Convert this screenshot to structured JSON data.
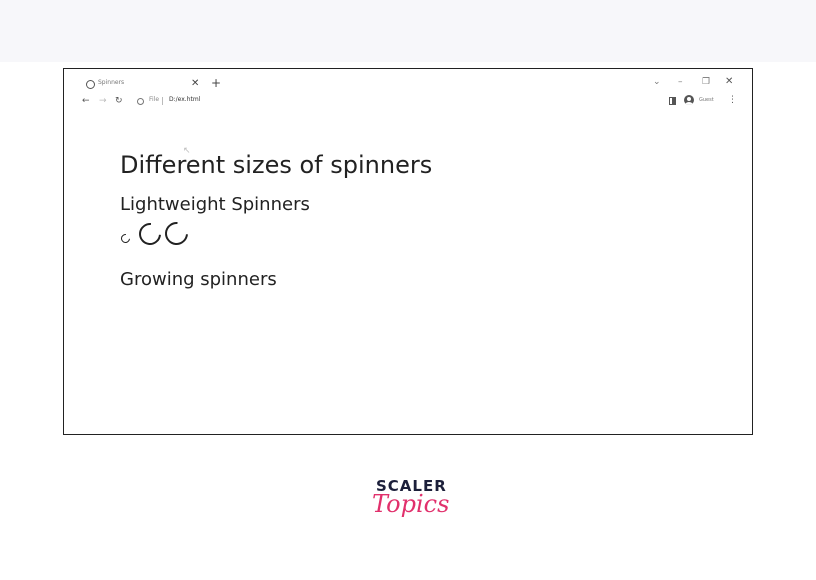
{
  "browser": {
    "tab": {
      "title": "Spinners",
      "close_glyph": "✕",
      "favicon": "globe-icon"
    },
    "new_tab_glyph": "+",
    "window_controls": {
      "tabs_menu": "⌄",
      "minimize": "–",
      "maximize": "❐",
      "close": "✕"
    },
    "toolbar": {
      "back": "←",
      "forward": "→",
      "reload": "↻",
      "scheme_label": "File",
      "url": "D:/ex.html",
      "profile_label": "Guest",
      "menu_glyph": "⋮"
    }
  },
  "page": {
    "heading": "Different sizes of spinners",
    "section_lightweight": "Lightweight Spinners",
    "section_growing": "Growing spinners"
  },
  "brand": {
    "line1": "SCALER",
    "line2": "Topics"
  }
}
